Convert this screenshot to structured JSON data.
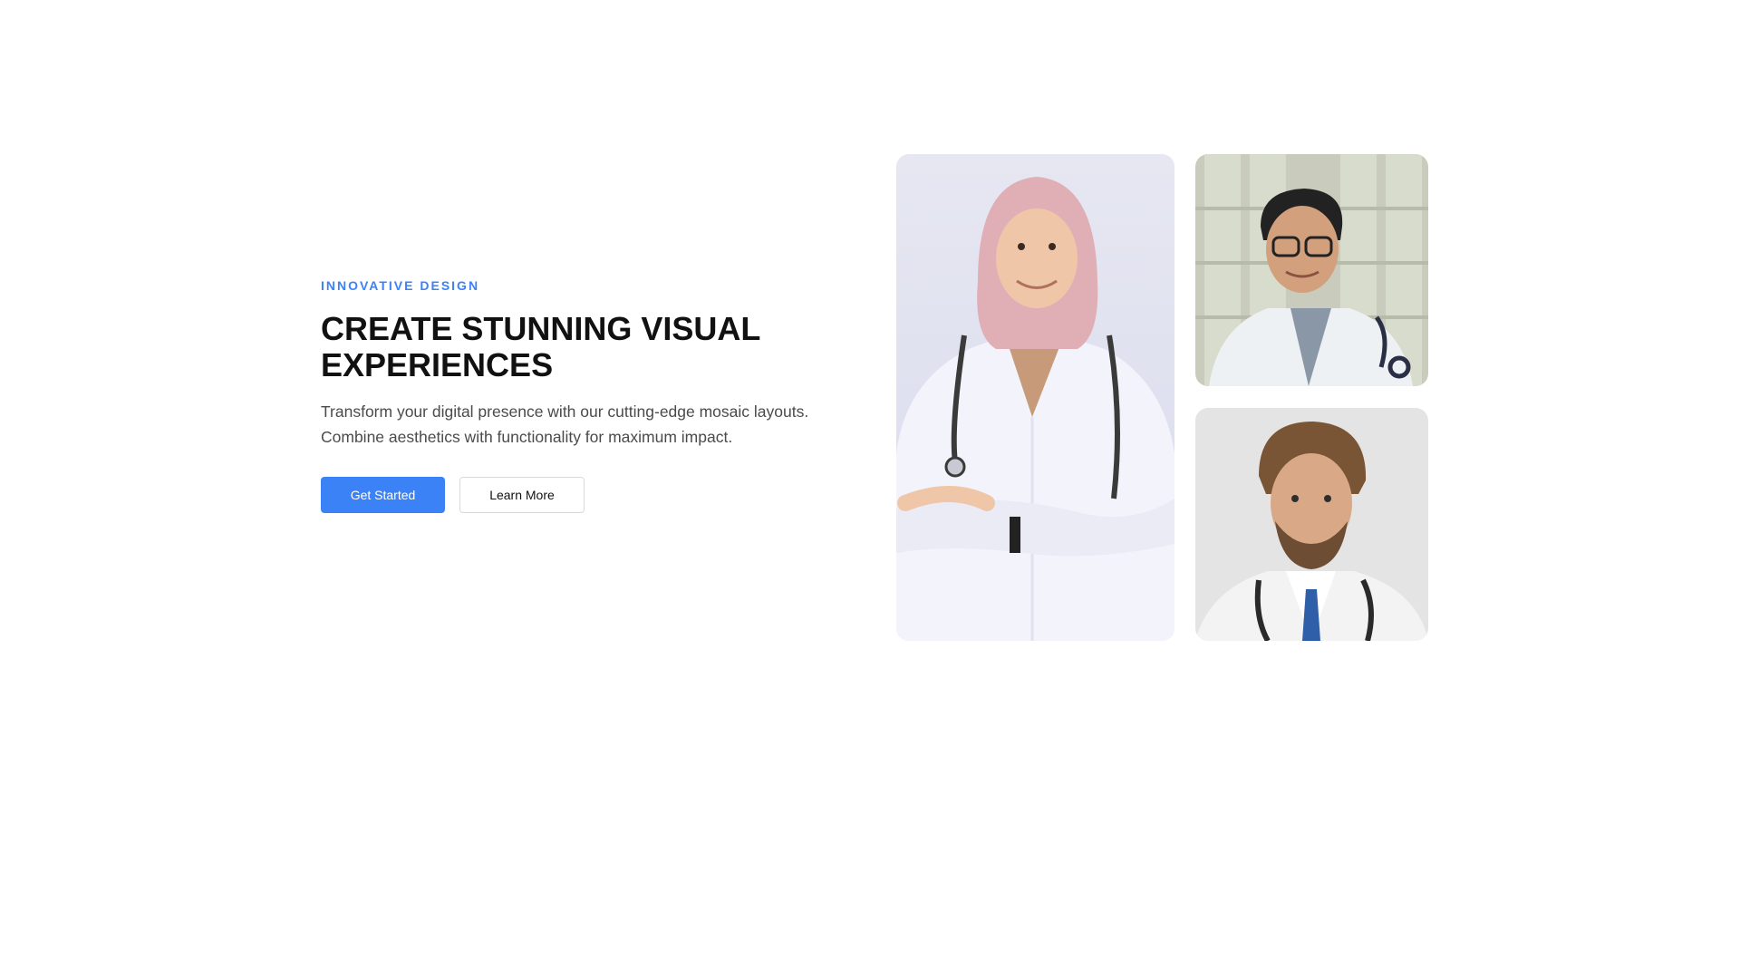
{
  "hero": {
    "eyebrow": "INNOVATIVE DESIGN",
    "title": "CREATE STUNNING VISUAL EXPERIENCES",
    "subtitle": "Transform your digital presence with our cutting-edge mosaic layouts. Combine aesthetics with functionality for maximum impact.",
    "primary_button": "Get Started",
    "secondary_button": "Learn More"
  },
  "colors": {
    "accent": "#3b82f6",
    "heading": "#111111",
    "body_text": "#4b4b4b"
  },
  "mosaic": {
    "images": [
      {
        "subject": "female-doctor-hijab-photo"
      },
      {
        "subject": "senior-male-doctor-glasses-photo"
      },
      {
        "subject": "male-doctor-beard-photo"
      }
    ]
  }
}
